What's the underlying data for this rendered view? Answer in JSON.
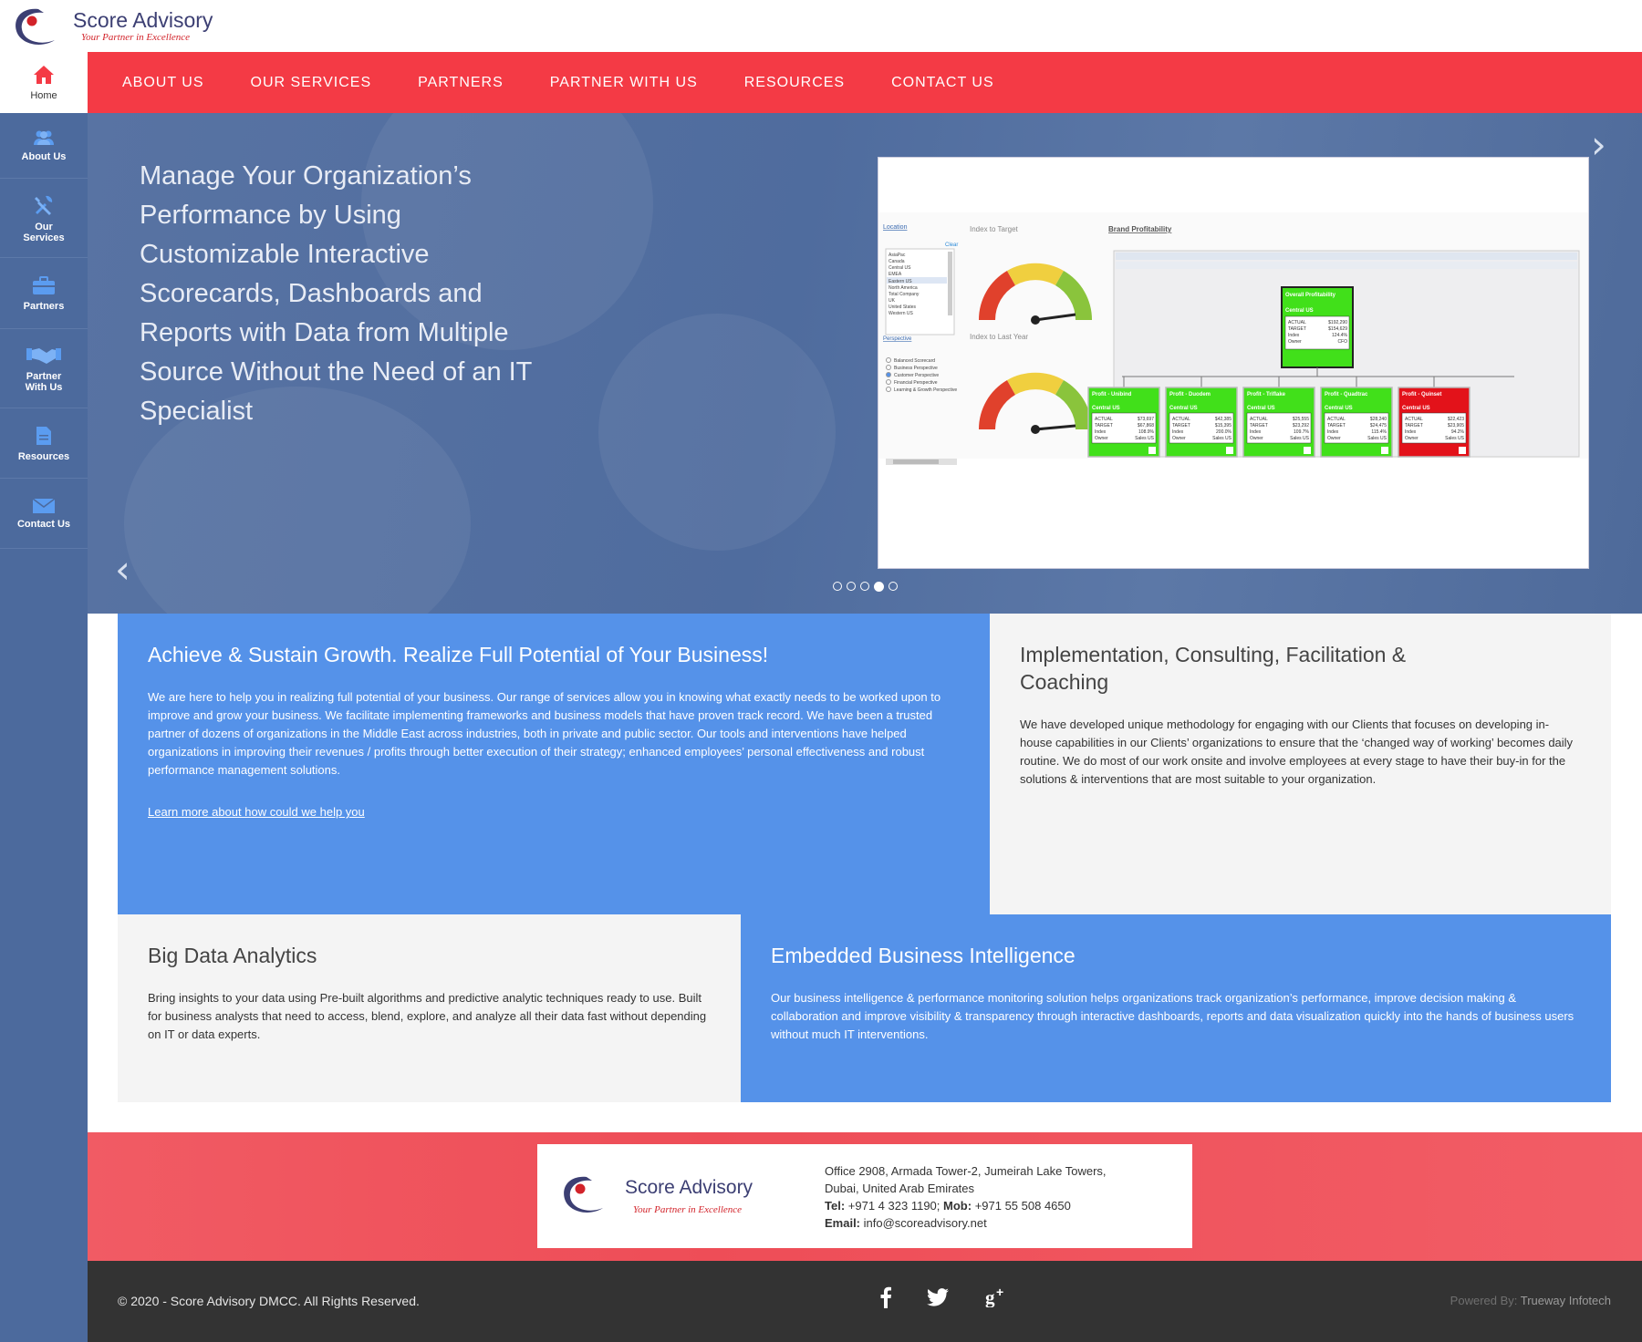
{
  "brand": {
    "name": "Score Advisory",
    "tagline": "Your Partner in Excellence",
    "colors": {
      "red": "#f43a45",
      "blue": "#5592e9",
      "sidebar": "#4c6a9d",
      "navy": "#3c3f73"
    }
  },
  "sidebar": {
    "items": [
      {
        "label": "Home",
        "icon": "home-icon"
      },
      {
        "label": "About Us",
        "icon": "users-icon"
      },
      {
        "label": "Our\nServices",
        "icon": "tools-icon"
      },
      {
        "label": "Partners",
        "icon": "briefcase-icon"
      },
      {
        "label": "Partner\nWith Us",
        "icon": "handshake-icon"
      },
      {
        "label": "Resources",
        "icon": "document-icon"
      },
      {
        "label": "Contact Us",
        "icon": "envelope-icon"
      }
    ]
  },
  "nav": {
    "items": [
      "ABOUT US",
      "OUR SERVICES",
      "PARTNERS",
      "PARTNER WITH US",
      "RESOURCES",
      "CONTACT US"
    ]
  },
  "hero": {
    "headline": "Manage Your Organization’s Performance by Using Customizable Interactive Scorecards, Dashboards and Reports with Data from Multiple Source Without the Need of an IT Specialist",
    "prev_icon": "chevron-left-icon",
    "next_icon": "chevron-right-icon",
    "slides_count": 5,
    "active_slide": 4,
    "screenshot": {
      "location_label": "Location",
      "clear_label": "Clear",
      "locations": [
        "AsiaPac",
        "Canada",
        "Central US",
        "EMEA",
        "Eastern US",
        "North America",
        "Total Company",
        "UK",
        "United States",
        "Western US"
      ],
      "perspective_label": "Perspective",
      "perspectives": [
        "Balanced Scorecard",
        "Business Perspective",
        "Customer Perspective",
        "Financial Perspective",
        "Learning & Growth Perspective"
      ],
      "gauge1_title": "Index to Target",
      "gauge2_title": "Index to Last Year",
      "brand_title": "Brand Profitability",
      "top_card": {
        "title": "Overall Profitability",
        "region": "Central US",
        "actual": "$192,290",
        "target": "$154,629",
        "index": "124.4%",
        "owner": "CFO"
      },
      "cards": [
        {
          "title": "Profit - Unibind",
          "region": "Central US",
          "actual": "$73,697",
          "target": "$67,868",
          "index": "108.9%",
          "owner": "Sales US",
          "status": "green"
        },
        {
          "title": "Profit - Duodem",
          "region": "Central US",
          "actual": "$42,385",
          "target": "$15,395",
          "index": "200.0%",
          "owner": "Sales US",
          "status": "green"
        },
        {
          "title": "Profit - Triflake",
          "region": "Central US",
          "actual": "$25,555",
          "target": "$23,292",
          "index": "109.7%",
          "owner": "Sales US",
          "status": "green"
        },
        {
          "title": "Profit - Quadtrac",
          "region": "Central US",
          "actual": "$28,240",
          "target": "$24,475",
          "index": "115.4%",
          "owner": "Sales US",
          "status": "green"
        },
        {
          "title": "Profit - Quinset",
          "region": "Central US",
          "actual": "$22,423",
          "target": "$23,905",
          "index": "94.2%",
          "owner": "Sales US",
          "status": "red"
        }
      ]
    }
  },
  "blocks": {
    "growth": {
      "title": "Achieve & Sustain Growth. Realize Full Potential of Your Business!",
      "body": "We are here to help you in realizing full potential of your business. Our range of services allow you in knowing what exactly needs to be worked upon to improve and grow your business. We facilitate implementing frameworks and business models that have proven track record. We have been a trusted partner of dozens of organizations in the Middle East across industries, both in private and public sector. Our tools and interventions have helped organizations in improving their revenues / profits through better execution of their strategy; enhanced employees’ personal effectiveness and robust performance management solutions.",
      "link": "Learn more about how could we help you"
    },
    "implementation": {
      "title": "Implementation, Consulting, Facilitation & Coaching",
      "body": "We have developed unique methodology for engaging with our Clients that focuses on developing in-house capabilities in our Clients’ organizations to ensure that the ‘changed way of working’ becomes daily routine. We do most of our work onsite and involve employees at every stage to have their buy-in for the solutions & interventions that are most suitable to your organization."
    },
    "bigdata": {
      "title": "Big Data Analytics",
      "body": "Bring insights to your data using Pre-built algorithms and predictive analytic techniques ready to use. Built for business analysts that need to access, blend, explore, and analyze all their data fast without depending on IT or data experts."
    },
    "embedded": {
      "title": "Embedded Business Intelligence",
      "body": "Our business intelligence & performance monitoring solution helps organizations track organization’s performance, improve decision making & collaboration and improve visibility & transparency through interactive dashboards, reports and data visualization quickly into the hands of business users without much IT interventions."
    }
  },
  "contact": {
    "address_line1": "Office 2908, Armada Tower-2, Jumeirah Lake Towers,",
    "address_line2": "Dubai, United Arab Emirates",
    "tel_label": "Tel:",
    "tel": "+971 4 323 1190;",
    "mob_label": "Mob:",
    "mob": "+971 55 508 4650",
    "email_label": "Email:",
    "email": "info@scoreadvisory.net"
  },
  "footer": {
    "copyright": "© 2020 - Score Advisory DMCC. All Rights Reserved.",
    "social": [
      "facebook-icon",
      "twitter-icon",
      "google-plus-icon"
    ],
    "powered_label": "Powered By:",
    "powered_by": "Trueway Infotech"
  }
}
